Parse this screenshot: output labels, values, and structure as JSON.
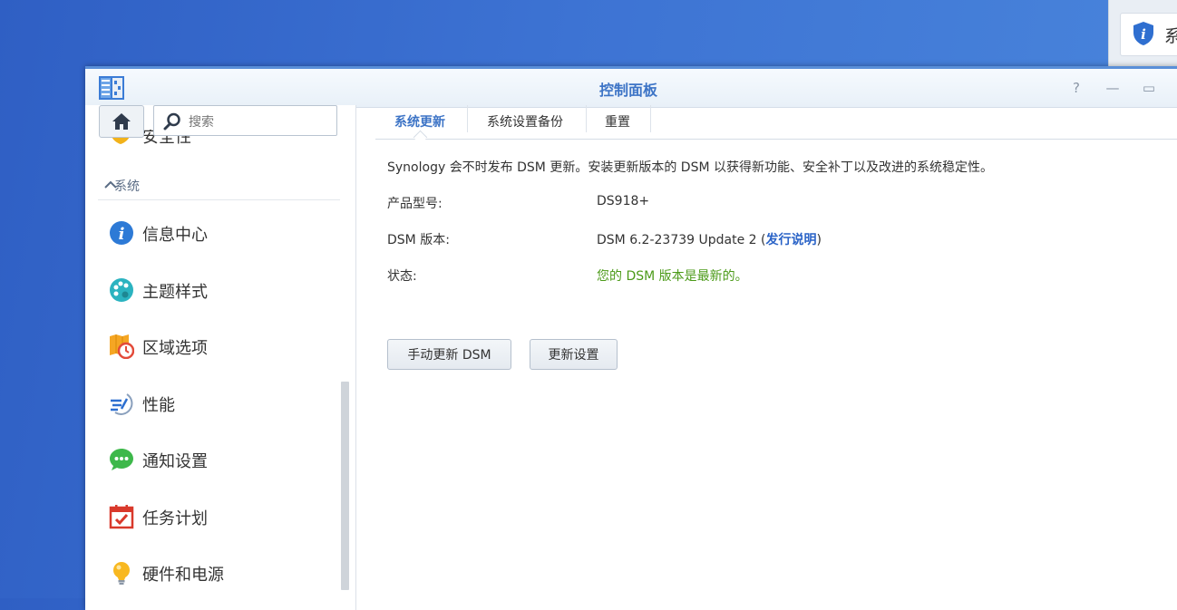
{
  "background_widget": {
    "text": "系"
  },
  "window": {
    "title": "控制面板",
    "help_symbol": "?",
    "minimize_symbol": "—",
    "maximize_symbol": "▭"
  },
  "sidebar": {
    "search_placeholder": "搜索",
    "partial_item_label": "安全性",
    "section_label": "系统",
    "items": [
      {
        "label": "信息中心",
        "icon": "info-icon"
      },
      {
        "label": "主题样式",
        "icon": "palette-icon"
      },
      {
        "label": "区域选项",
        "icon": "region-clock-icon"
      },
      {
        "label": "性能",
        "icon": "performance-icon"
      },
      {
        "label": "通知设置",
        "icon": "chat-bubble-icon"
      },
      {
        "label": "任务计划",
        "icon": "calendar-check-icon"
      },
      {
        "label": "硬件和电源",
        "icon": "lightbulb-icon"
      }
    ]
  },
  "tabs": [
    {
      "label": "系统更新",
      "active": true
    },
    {
      "label": "系统设置备份",
      "active": false
    },
    {
      "label": "重置",
      "active": false
    }
  ],
  "main": {
    "description": "Synology 会不时发布 DSM 更新。安装更新版本的 DSM 以获得新功能、安全补丁以及改进的系统稳定性。",
    "model_label": "产品型号:",
    "model_value": "DS918+",
    "version_label": "DSM 版本:",
    "version_value": "DSM 6.2-23739 Update 2 (",
    "release_notes_link": "发行说明",
    "version_suffix": ")",
    "status_label": "状态:",
    "status_value": "您的 DSM 版本是最新的。",
    "manual_update_button": "手动更新 DSM",
    "update_settings_button": "更新设置"
  },
  "colors": {
    "accent": "#3d74c6",
    "status_ok": "#4b9a18",
    "link": "#2a63c7",
    "desktop": "#3d73d3"
  }
}
